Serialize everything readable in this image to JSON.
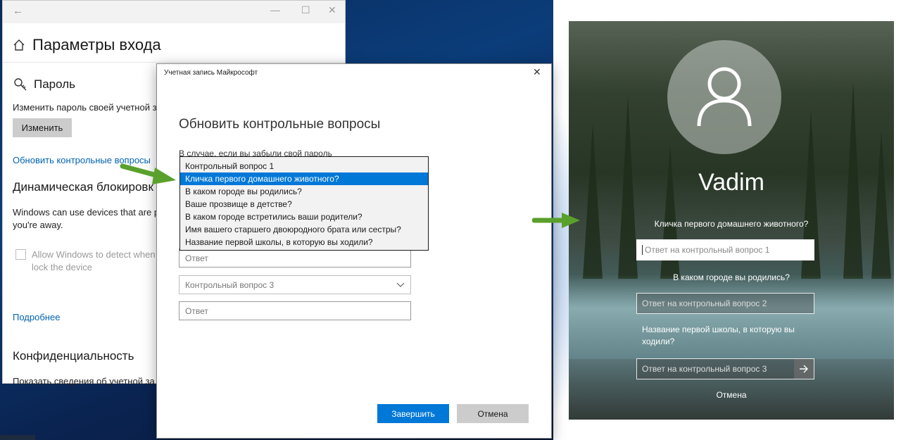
{
  "settings": {
    "title": "Параметры входа",
    "password_heading": "Пароль",
    "password_desc": "Изменить пароль своей учетной за",
    "change_button": "Изменить",
    "update_link": "Обновить контрольные вопросы",
    "dynamic_lock_heading": "Динамическая блокировк",
    "dynamic_lock_desc_1": "Windows can use devices that are pa",
    "dynamic_lock_desc_2": "you're away.",
    "checkbox_label_1": "Allow Windows to detect when y",
    "checkbox_label_2": "lock the device",
    "more_link": "Подробнее",
    "privacy_heading": "Конфиденциальность",
    "privacy_desc": "Показать сведения об учетной за"
  },
  "dialog": {
    "title": "Учетная запись Майкрософт",
    "heading": "Обновить контрольные вопросы",
    "subtext": "В случае, если вы забыли свой пароль",
    "answer_placeholder": "Ответ",
    "question3_placeholder": "Контрольный вопрос 3",
    "finish_button": "Завершить",
    "cancel_button": "Отмена"
  },
  "dropdown": {
    "items": [
      "Контрольный вопрос 1",
      "Кличка первого домашнего животного?",
      "В каком городе вы родились?",
      "Ваше прозвище в детстве?",
      "В каком городе встретились ваши родители?",
      "Имя вашего старшего двоюродного брата или сестры?",
      "Название первой школы, в которую вы ходили?"
    ],
    "selected_index": 1
  },
  "lock_screen": {
    "user_name": "Vadim",
    "question_1": "Кличка первого домашнего животного?",
    "answer_1_placeholder": "Ответ на контрольный вопрос 1",
    "question_2": "В каком городе вы родились?",
    "answer_2_placeholder": "Ответ на контрольный вопрос 2",
    "question_3": "Название первой школы, в которую вы ходили?",
    "answer_3_placeholder": "Ответ на контрольный вопрос 3",
    "cancel_link": "Отмена"
  },
  "colors": {
    "accent": "#0078d7",
    "link": "#0063b1",
    "arrow": "#5aa02c"
  },
  "icons": [
    "back-arrow-icon",
    "minimize-icon",
    "maximize-icon",
    "close-icon",
    "home-icon",
    "key-icon",
    "chevron-down-icon",
    "user-avatar-icon",
    "submit-arrow-icon",
    "green-arrow-icon"
  ]
}
